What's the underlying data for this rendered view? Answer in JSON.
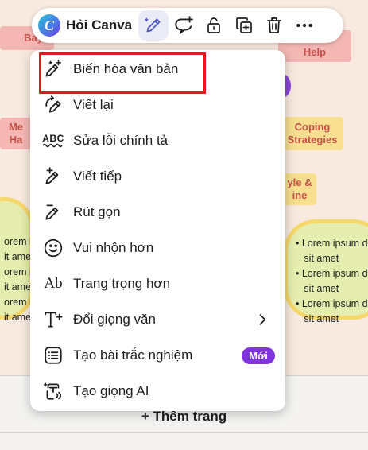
{
  "toolbar": {
    "ask_canva_label": "Hỏi Canva",
    "logo_letter": "C",
    "icons": [
      "magic-write-icon",
      "comment-add-icon",
      "lock-icon",
      "duplicate-icon",
      "trash-icon",
      "more-icon"
    ]
  },
  "menu": {
    "items": [
      {
        "label": "Biến hóa văn bản",
        "icon": "magic-pen-icon"
      },
      {
        "label": "Viết lại",
        "icon": "rewrite-icon"
      },
      {
        "label": "Sửa lỗi chính tả",
        "icon": "spellcheck-icon"
      },
      {
        "label": "Viết tiếp",
        "icon": "continue-writing-icon"
      },
      {
        "label": "Rút gọn",
        "icon": "shorten-icon"
      },
      {
        "label": "Vui nhộn hơn",
        "icon": "smile-icon"
      },
      {
        "label": "Trang trọng hơn",
        "icon": "formal-text-icon"
      },
      {
        "label": "Đổi giọng văn",
        "icon": "change-tone-icon"
      },
      {
        "label": "Tạo bài trắc nghiệm",
        "icon": "quiz-icon",
        "badge": "Mới"
      },
      {
        "label": "Tạo giọng AI",
        "icon": "ai-voice-icon"
      }
    ],
    "spellcheck_glyph": "ABC",
    "formal_glyph": "Ab"
  },
  "canvas": {
    "top_left_fragment": "Bay",
    "top_right_fragment": "nal\nHelp",
    "left_fragment": "Me\nHa",
    "coping": "Coping\nStrategies",
    "style_fragment": "yle &\nine",
    "left_list": "orem ipsum\nit amet\norem ipsum\nit amet\norem ipsum\nit amet",
    "right_list": "• Lorem ipsum d\n   sit amet\n• Lorem ipsum d\n   sit amet\n• Lorem ipsum d\n   sit amet"
  },
  "bottom": {
    "add_page": "+ Thêm trang"
  },
  "colors": {
    "highlight": "#e4161b",
    "badge": "#8233e0",
    "brand_gradient_start": "#24c6dc",
    "brand_gradient_end": "#6a3de8"
  }
}
